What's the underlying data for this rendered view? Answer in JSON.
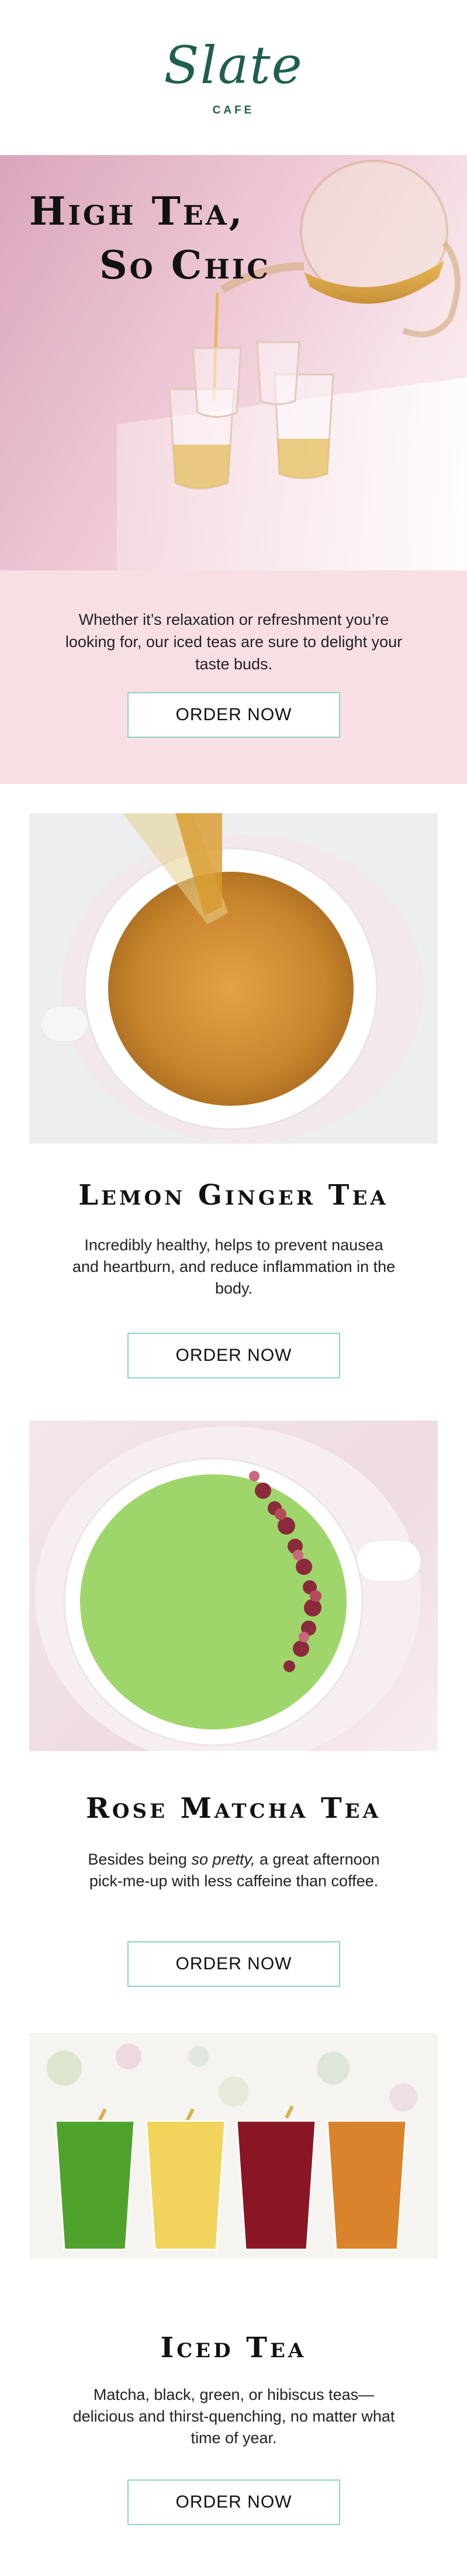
{
  "brand": {
    "name": "Slate",
    "sub": "CAFE"
  },
  "hero": {
    "title_line1": "High Tea,",
    "title_line2": "So Chic",
    "text": "Whether it’s relaxation or refreshment you’re looking for, our iced teas are sure to delight your taste buds.",
    "button_label": "ORDER NOW"
  },
  "products": [
    {
      "title": "Lemon Ginger Tea",
      "desc": "Incredibly healthy, helps to prevent nausea and heartburn, and reduce inflammation in the body.",
      "button_label": "ORDER NOW"
    },
    {
      "title": "Rose Matcha Tea",
      "desc_before": "Besides being ",
      "desc_em": "so pretty,",
      "desc_after": " a great afternoon pick-me-up with less caffeine than coffee.",
      "button_label": "ORDER NOW"
    },
    {
      "title": "Iced Tea",
      "desc": "Matcha, black, green, or hibiscus teas—delicious and thirst-quenching, no matter what time of year.",
      "button_label": "ORDER NOW"
    }
  ],
  "colors": {
    "brand_green": "#1f5e50",
    "button_border": "#8fd3c7",
    "hero_panel": "#f8dfe4",
    "tea_amber": "#c98a2f",
    "matcha_green": "#9fd66b",
    "hibiscus_red": "#8a1525"
  }
}
